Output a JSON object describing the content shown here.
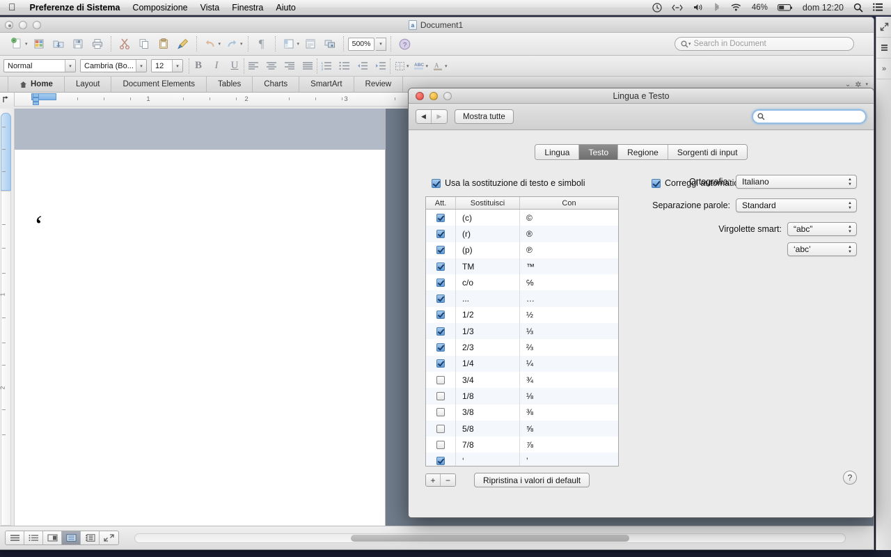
{
  "menubar": {
    "apple_icon": "apple-icon",
    "items": [
      {
        "label": "Preferenze di Sistema",
        "bold": true
      },
      {
        "label": "Composizione",
        "bold": false
      },
      {
        "label": "Vista",
        "bold": false
      },
      {
        "label": "Finestra",
        "bold": false
      },
      {
        "label": "Aiuto",
        "bold": false
      }
    ],
    "status": {
      "battery_percent": "46%",
      "clock": "dom 12:20",
      "icons": [
        "timemachine-icon",
        "display-mirror-icon",
        "volume-icon",
        "bluetooth-icon",
        "wifi-icon",
        "battery-icon",
        "spotlight-search-icon",
        "notification-center-icon"
      ]
    }
  },
  "word": {
    "title": "Document1",
    "doc_icon": "word-document-icon",
    "traffic": [
      "close-button",
      "minimize-button",
      "zoom-button"
    ],
    "toolbar": {
      "buttons": [
        {
          "name": "new-document-button",
          "icon": "new-doc-icon",
          "menu": true
        },
        {
          "name": "open-gallery-button",
          "icon": "gallery-icon",
          "menu": false
        },
        {
          "name": "open-button",
          "icon": "open-folder-icon",
          "menu": false
        },
        {
          "name": "save-button",
          "icon": "save-floppy-icon",
          "menu": false
        },
        {
          "name": "print-button",
          "icon": "printer-icon",
          "menu": false
        },
        {
          "name": "cut-button",
          "icon": "scissors-icon",
          "menu": false
        },
        {
          "name": "copy-button",
          "icon": "copy-icon",
          "menu": false
        },
        {
          "name": "paste-button",
          "icon": "paste-icon",
          "menu": false
        },
        {
          "name": "format-painter-button",
          "icon": "paintbrush-icon",
          "menu": false
        },
        {
          "name": "undo-button",
          "icon": "undo-arrow-icon",
          "menu": true
        },
        {
          "name": "redo-button",
          "icon": "redo-arrow-icon",
          "menu": true
        },
        {
          "name": "show-formatting-button",
          "icon": "pilcrow-icon",
          "menu": false
        },
        {
          "name": "sidebar-button",
          "icon": "sidebar-panel-icon",
          "menu": true
        },
        {
          "name": "header-footer-button",
          "icon": "header-footer-icon",
          "menu": false
        },
        {
          "name": "media-browser-button",
          "icon": "media-browser-icon",
          "menu": false
        }
      ],
      "zoom_value": "500%",
      "help_icon": "help-circle-icon",
      "search_placeholder": "Search in Document",
      "search_value": "",
      "search_icon": "magnifier-icon"
    },
    "formatbar": {
      "style_value": "Normal",
      "font_value": "Cambria (Bo...",
      "size_value": "12",
      "buttons": [
        {
          "name": "bold-button",
          "label": "B"
        },
        {
          "name": "italic-button",
          "label": "I"
        },
        {
          "name": "underline-button",
          "label": "U"
        },
        {
          "name": "align-left-button",
          "label": "align-left-icon"
        },
        {
          "name": "align-center-button",
          "label": "align-center-icon"
        },
        {
          "name": "align-right-button",
          "label": "align-right-icon"
        },
        {
          "name": "align-justify-button",
          "label": "align-justify-icon"
        },
        {
          "name": "numbered-list-button",
          "label": "numbered-list-icon"
        },
        {
          "name": "bulleted-list-button",
          "label": "bulleted-list-icon"
        },
        {
          "name": "decrease-indent-button",
          "label": "decrease-indent-icon"
        },
        {
          "name": "increase-indent-button",
          "label": "increase-indent-icon"
        },
        {
          "name": "borders-button",
          "label": "borders-icon"
        },
        {
          "name": "highlight-button",
          "label": "highlight-abc-icon"
        },
        {
          "name": "font-color-button",
          "label": "font-color-A-icon"
        }
      ]
    },
    "ribbon_tabs": [
      {
        "label": "Home",
        "icon": "home-icon",
        "active": true
      },
      {
        "label": "Layout",
        "icon": "",
        "active": false
      },
      {
        "label": "Document Elements",
        "icon": "",
        "active": false
      },
      {
        "label": "Tables",
        "icon": "",
        "active": false
      },
      {
        "label": "Charts",
        "icon": "",
        "active": false
      },
      {
        "label": "SmartArt",
        "icon": "",
        "active": false
      },
      {
        "label": "Review",
        "icon": "",
        "active": false
      }
    ],
    "ribbon_right_icons": [
      "chevron-down-icon",
      "gear-icon"
    ],
    "ruler": {
      "tab_selector_icon": "tab-stop-icon",
      "numbers": [
        "1",
        "2",
        "3"
      ],
      "vertical_numbers": [
        "1",
        "2"
      ]
    },
    "document_text": "‘",
    "bottom": {
      "view_buttons": [
        {
          "name": "draft-view-button",
          "icon": "draft-view-icon",
          "active": false
        },
        {
          "name": "outline-view-button",
          "icon": "outline-view-icon",
          "active": false
        },
        {
          "name": "publishing-view-button",
          "icon": "publishing-view-icon",
          "active": false
        },
        {
          "name": "print-layout-view-button",
          "icon": "print-layout-icon",
          "active": true
        },
        {
          "name": "notebook-view-button",
          "icon": "notebook-view-icon",
          "active": false
        },
        {
          "name": "fullscreen-view-button",
          "icon": "fullscreen-icon",
          "active": false
        }
      ]
    },
    "side_rail_icons": [
      "expand-diagonal-icon",
      "toolbox-lines-icon",
      "chevron-double-right-icon"
    ]
  },
  "prefs": {
    "title": "Lingua e Testo",
    "traffic": [
      "close-button",
      "minimize-button",
      "zoom-button"
    ],
    "toolbar": {
      "back_icon": "chevron-left-icon",
      "forward_icon": "chevron-right-icon",
      "show_all_label": "Mostra tutte",
      "search_value": "",
      "search_placeholder": "",
      "search_icon": "magnifier-icon"
    },
    "tabs": [
      {
        "label": "Lingua",
        "selected": false
      },
      {
        "label": "Testo",
        "selected": true
      },
      {
        "label": "Regione",
        "selected": false
      },
      {
        "label": "Sorgenti di input",
        "selected": false
      }
    ],
    "substitution_checkbox": {
      "label": "Usa la sostituzione di testo e simboli",
      "checked": true
    },
    "autocorrect_checkbox": {
      "label": "Correggi automaticamente ortografia",
      "checked": true
    },
    "table": {
      "headers": [
        "Att.",
        "Sostituisci",
        "Con"
      ],
      "rows": [
        {
          "on": true,
          "replace": "(c)",
          "with": "©"
        },
        {
          "on": true,
          "replace": "(r)",
          "with": "®"
        },
        {
          "on": true,
          "replace": "(p)",
          "with": "℗"
        },
        {
          "on": true,
          "replace": "TM",
          "with": "™"
        },
        {
          "on": true,
          "replace": "c/o",
          "with": "℅"
        },
        {
          "on": true,
          "replace": "...",
          "with": "…"
        },
        {
          "on": true,
          "replace": "1/2",
          "with": "½"
        },
        {
          "on": true,
          "replace": "1/3",
          "with": "⅓"
        },
        {
          "on": true,
          "replace": "2/3",
          "with": "⅔"
        },
        {
          "on": true,
          "replace": "1/4",
          "with": "¼"
        },
        {
          "on": false,
          "replace": "3/4",
          "with": "¾"
        },
        {
          "on": false,
          "replace": "1/8",
          "with": "⅛"
        },
        {
          "on": false,
          "replace": "3/8",
          "with": "⅜"
        },
        {
          "on": false,
          "replace": "5/8",
          "with": "⅝"
        },
        {
          "on": false,
          "replace": "7/8",
          "with": "⅞"
        },
        {
          "on": true,
          "replace": "‘",
          "with": "’"
        }
      ]
    },
    "form": {
      "spelling_label": "Ortografia:",
      "spelling_value": "Italiano",
      "hyphenation_label": "Separazione parole:",
      "hyphenation_value": "Standard",
      "smartquotes_label": "Virgolette smart:",
      "smartquotes_double_value": "“abc”",
      "smartquotes_single_value": "‘abc’"
    },
    "add_button": "+",
    "remove_button": "−",
    "restore_button": "Ripristina i valori di default",
    "help_button": "?"
  }
}
